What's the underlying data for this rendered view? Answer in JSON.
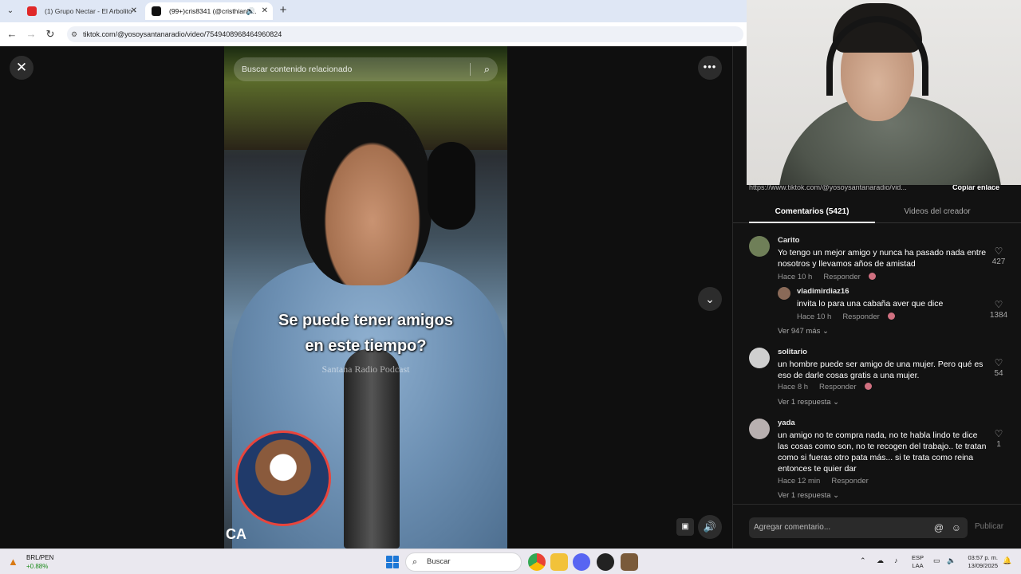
{
  "browser": {
    "tabs": [
      {
        "title": "(1) Grupo Nectar - El Arbolito -"
      },
      {
        "title": "(99+)cris8341 (@cristhian8..."
      }
    ],
    "url": "tiktok.com/@yosoysantanaradio/video/7549408968464960824"
  },
  "video": {
    "search_placeholder": "Buscar contenido relacionado",
    "caption_line1": "Se puede tener amigos",
    "caption_line2": "en este tiempo?",
    "watermark": "Santana Radio Podcast",
    "corner_text": "CA"
  },
  "panel": {
    "link_text": "https://www.tiktok.com/@yosoysantanaradio/vid...",
    "copy_link": "Copiar enlace",
    "tab_comments": "Comentarios (5421)",
    "tab_videos": "Videos del creador",
    "comments": [
      {
        "user": "Carito",
        "text": "Yo tengo un mejor amigo y nunca ha pasado nada entre nosotros y llevamos años de amistad",
        "time": "Hace 10 h",
        "reply": "Responder",
        "likes": "427"
      },
      {
        "user": "vladimirdiaz16",
        "text": "invita lo para una cabaña aver que dice",
        "time": "Hace 10 h",
        "reply": "Responder",
        "likes": "1384"
      },
      {
        "user": "solitario",
        "text": "un hombre puede ser amigo de una mujer. Pero qué es eso de darle cosas gratis a una mujer.",
        "time": "Hace 8 h",
        "reply": "Responder",
        "likes": "54"
      },
      {
        "user": "yada",
        "text": "un amigo no te compra nada, no te habla lindo te dice las cosas como son, no te recogen del trabajo.. te tratan como si fueras otro pata más... si te trata como reina entonces te quier dar",
        "time": "Hace 12 min",
        "reply": "Responder",
        "likes": "1"
      }
    ],
    "more_replies_1": "Ver 947 más",
    "more_replies_2": "Ver 1 respuesta",
    "more_replies_3": "Ver 1 respuesta",
    "compose_placeholder": "Agregar comentario...",
    "publish": "Publicar"
  },
  "taskbar": {
    "stock_name": "BRL/PEN",
    "stock_change": "+0.88%",
    "search_label": "Buscar",
    "lang_line1": "ESP",
    "lang_line2": "LAA",
    "time": "03:57 p. m.",
    "date": "13/09/2025"
  },
  "icons": [
    "close-icon",
    "more-icon",
    "chevron-down-icon",
    "search-icon",
    "volume-icon",
    "heart-icon",
    "mention-icon",
    "emoji-icon",
    "windows-icon"
  ],
  "colors": {
    "accent": "#fe2c55",
    "panel_bg": "#121212",
    "avatar_ring": "#e8453c"
  }
}
